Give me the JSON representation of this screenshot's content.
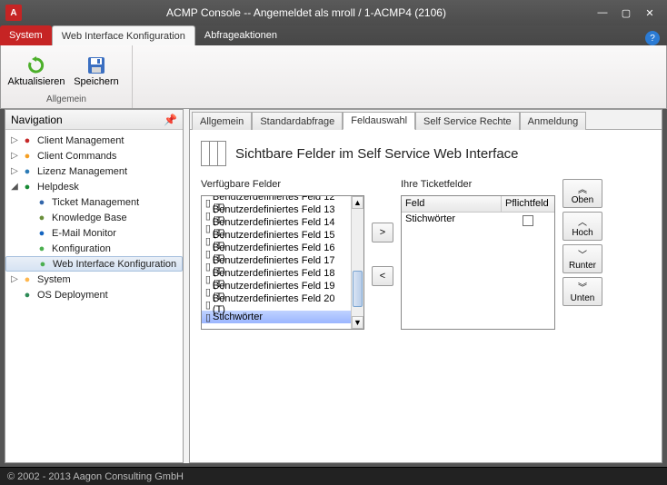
{
  "window": {
    "title": "ACMP Console -- Angemeldet als mroll / 1-ACMP4 (2106)",
    "logo_letter": "A"
  },
  "ribbon_tabs": {
    "system": "System",
    "web_interface": "Web Interface Konfiguration",
    "abfrage": "Abfrageaktionen"
  },
  "ribbon": {
    "aktualisieren": "Aktualisieren",
    "speichern": "Speichern",
    "group_label": "Allgemein"
  },
  "nav": {
    "header": "Navigation",
    "items": [
      {
        "label": "Client Management",
        "indent": 0,
        "twisty": "▷",
        "color": "#c62828"
      },
      {
        "label": "Client Commands",
        "indent": 0,
        "twisty": "▷",
        "color": "#f59f24"
      },
      {
        "label": "Lizenz Management",
        "indent": 0,
        "twisty": "▷",
        "color": "#2c7bb6"
      },
      {
        "label": "Helpdesk",
        "indent": 0,
        "twisty": "◢",
        "color": "#178a34"
      },
      {
        "label": "Ticket Management",
        "indent": 1,
        "twisty": "",
        "color": "#3366aa"
      },
      {
        "label": "Knowledge Base",
        "indent": 1,
        "twisty": "",
        "color": "#6a8f3a"
      },
      {
        "label": "E-Mail Monitor",
        "indent": 1,
        "twisty": "",
        "color": "#1565c0"
      },
      {
        "label": "Konfiguration",
        "indent": 1,
        "twisty": "",
        "color": "#4caf50"
      },
      {
        "label": "Web Interface Konfiguration",
        "indent": 1,
        "twisty": "",
        "color": "#4caf50",
        "selected": true
      },
      {
        "label": "System",
        "indent": 0,
        "twisty": "▷",
        "color": "#ffb74d"
      },
      {
        "label": "OS Deployment",
        "indent": 0,
        "twisty": "",
        "color": "#2e8b57"
      }
    ]
  },
  "content_tabs": {
    "t0": "Allgemein",
    "t1": "Standardabfrage",
    "t2": "Feldauswahl",
    "t3": "Self Service Rechte",
    "t4": "Anmeldung"
  },
  "heading": "Sichtbare Felder im Self Service Web Interface",
  "available": {
    "title": "Verfügbare Felder",
    "items": [
      "Benutzerdefiniertes Feld 12 (T)",
      "Benutzerdefiniertes Feld 13 (T)",
      "Benutzerdefiniertes Feld 14 (T)",
      "Benutzerdefiniertes Feld 15 (T)",
      "Benutzerdefiniertes Feld 16 (T)",
      "Benutzerdefiniertes Feld 17 (T)",
      "Benutzerdefiniertes Feld 18 (T)",
      "Benutzerdefiniertes Feld 19 (T)",
      "Benutzerdefiniertes Feld 20 (T)",
      "Stichwörter"
    ],
    "selected_index": 9
  },
  "selected": {
    "title": "Ihre Ticketfelder",
    "col_field": "Feld",
    "col_required": "Pflichtfeld",
    "rows": [
      {
        "field": "Stichwörter",
        "required": false
      }
    ]
  },
  "move_buttons": {
    "right": ">",
    "left": "<"
  },
  "order_buttons": {
    "top": "Oben",
    "up": "Hoch",
    "down": "Runter",
    "bottom": "Unten"
  },
  "footer": "© 2002 - 2013 Aagon Consulting GmbH"
}
